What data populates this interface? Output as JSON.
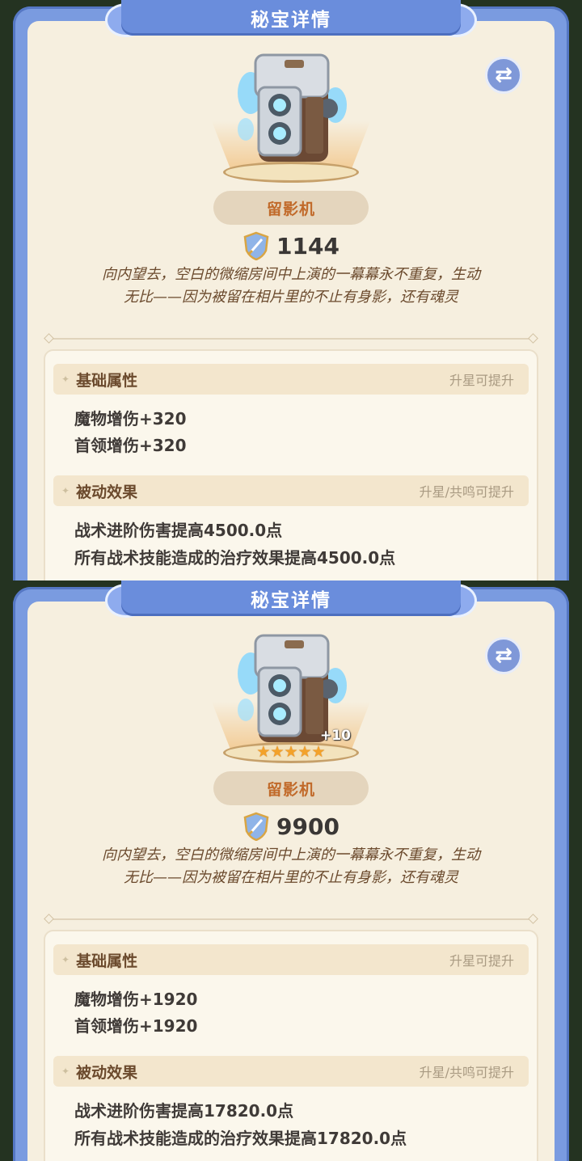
{
  "panels": [
    {
      "title": "秘宝详情",
      "swap_icon": "⇄",
      "artifact_name": "留影机",
      "power": "1144",
      "description": [
        "向内望去，空白的微缩房间中上演的一幕幕永不重复，生动",
        "无比——因为被留在相片里的不止有身影，还有魂灵"
      ],
      "stars": "",
      "enhance_level": "",
      "basic": {
        "title": "基础属性",
        "hint": "升星可提升",
        "stats": [
          "魔物增伤+320",
          "首领增伤+320"
        ]
      },
      "passive": {
        "title": "被动效果",
        "hint": "升星/共鸣可提升",
        "effects": [
          "战术进阶伤害提高4500.0点",
          "所有战术技能造成的治疗效果提高4500.0点"
        ]
      }
    },
    {
      "title": "秘宝详情",
      "swap_icon": "⇄",
      "artifact_name": "留影机",
      "power": "9900",
      "description": [
        "向内望去，空白的微缩房间中上演的一幕幕永不重复，生动",
        "无比——因为被留在相片里的不止有身影，还有魂灵"
      ],
      "stars": "★★★★★",
      "enhance_level": "+10",
      "basic": {
        "title": "基础属性",
        "hint": "升星可提升",
        "stats": [
          "魔物增伤+1920",
          "首领增伤+1920"
        ]
      },
      "passive": {
        "title": "被动效果",
        "hint": "升星/共鸣可提升",
        "effects": [
          "战术进阶伤害提高17820.0点",
          "所有战术技能造成的治疗效果提高17820.0点"
        ]
      }
    }
  ],
  "colors": {
    "frame": "#7a9be0",
    "card": "#f6efdf",
    "name_text": "#c16a2a",
    "star": "#f3a22a"
  }
}
